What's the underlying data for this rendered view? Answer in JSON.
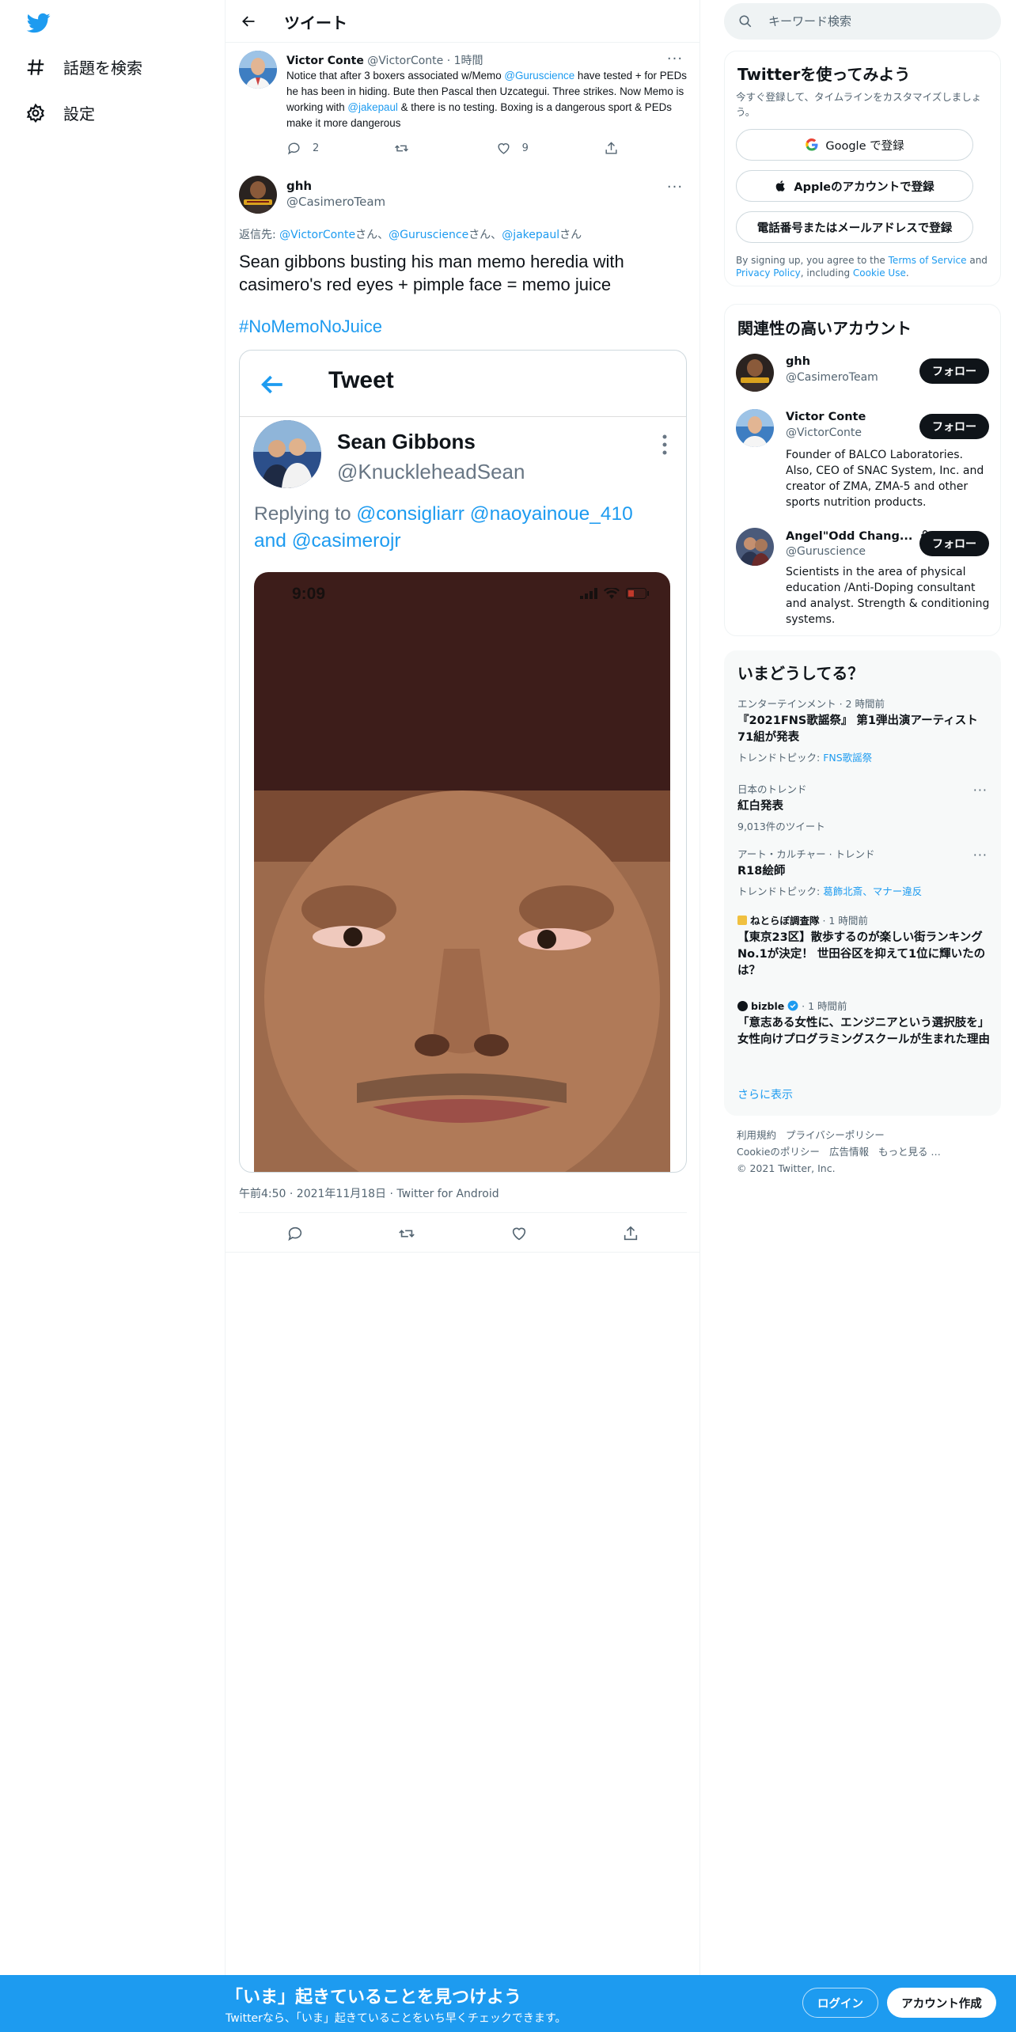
{
  "nav": {
    "explore_label": "話題を検索",
    "settings_label": "設定"
  },
  "header": {
    "title": "ツイート"
  },
  "parent_tweet": {
    "name": "Victor Conte",
    "handle": "@VictorConte",
    "time": "· 1時間",
    "text_part1": "Notice that after 3 boxers associated w/Memo ",
    "mention1": "@Guruscience",
    "text_part2": " have tested + for PEDs he has been in hiding.  Bute then Pascal then Uzcategui. Three strikes.  Now Memo is working with ",
    "mention2": "@jakepaul",
    "text_part3": " & there is no testing. Boxing is a dangerous sport & PEDs make it more dangerous",
    "reply_count": "2",
    "retweet_count": "",
    "like_count": "9"
  },
  "main_tweet": {
    "name": "ghh",
    "handle": "@CasimeroTeam",
    "reply_prefix": "返信先: ",
    "reply_mentions": [
      "@VictorConte",
      "さん、",
      "@Guruscience",
      "さん、",
      "@jakepaul",
      "さん"
    ],
    "text": "Sean gibbons busting his man memo heredia with casimero's red eyes + pimple face = memo juice",
    "hashtag": "#NoMemoNoJuice",
    "timestamp": "午前4:50 · 2021年11月18日 · Twitter for Android"
  },
  "embedded_image": {
    "header_title": "Tweet",
    "name": "Sean Gibbons",
    "handle": "@KnuckleheadSean",
    "reply_label": "Replying to ",
    "reply_mentions": "@consigliarr @naoyainoue_410",
    "reply_and": "and ",
    "reply_last": "@casimerojr",
    "phone_time": "9:09"
  },
  "search": {
    "placeholder": "キーワード検索"
  },
  "signup_panel": {
    "title": "Twitterを使ってみよう",
    "subtitle": "今すぐ登録して、タイムラインをカスタマイズしましょう。",
    "google_label": "Google で登録",
    "apple_label": "Appleのアカウントで登録",
    "phone_label": "電話番号またはメールアドレスで登録",
    "terms_part1": "By signing up, you agree to the ",
    "terms_link": "Terms of Service",
    "terms_part2": " and ",
    "privacy_link": "Privacy Policy",
    "terms_part3": ", including ",
    "cookie_link": "Cookie Use",
    "terms_part4": "."
  },
  "related_panel": {
    "title": "関連性の高いアカウント",
    "follow_label": "フォロー",
    "accounts": [
      {
        "name": "ghh",
        "handle": "@CasimeroTeam",
        "bio": ""
      },
      {
        "name": "Victor Conte",
        "handle": "@VictorConte",
        "bio": "Founder of BALCO Laboratories. Also, CEO of SNAC System, Inc. and creator of ZMA, ZMA-5 and other sports nutrition products."
      },
      {
        "name": "Angel\"Odd Chang...",
        "handle": "@Guruscience",
        "bio": "Scientists in the area of physical education /Anti-Doping consultant and analyst. Strength & conditioning systems."
      }
    ]
  },
  "trends_panel": {
    "title": "いまどうしてる？",
    "show_more": "さらに表示",
    "items": [
      {
        "meta": "エンターテインメント · 2 時間前",
        "title": "『2021FNS歌謡祭』 第1弾出演アーティスト71組が発表",
        "sub_label": "トレンドトピック: ",
        "sub_link": "FNS歌謡祭"
      },
      {
        "meta": "日本のトレンド",
        "title": "紅白発表",
        "sub_label": "9,013件のツイート",
        "sub_link": ""
      },
      {
        "meta": "アート・カルチャー · トレンド",
        "title": "R18絵師",
        "sub_label": "トレンドトピック: ",
        "sub_link": "葛飾北斎、マナー違反"
      },
      {
        "meta_name": "ねとらぼ調査隊",
        "meta": " · 1 時間前",
        "title": "【東京23区】散歩するのが楽しい街ランキングNo.1が決定！ 世田谷区を抑えて1位に輝いたのは？"
      },
      {
        "meta_name": "bizble",
        "meta": " · 1 時間前",
        "title": "「意志ある女性に、エンジニアという選択肢を」　女性向けプログラミングスクールが生まれた理由"
      }
    ]
  },
  "footer": {
    "links": [
      "利用規約",
      "プライバシーポリシー",
      "Cookieのポリシー",
      "広告情報",
      "もっと見る …"
    ],
    "copyright": "© 2021 Twitter, Inc."
  },
  "bottom_bar": {
    "title": "「いま」起きていることを見つけよう",
    "subtitle": "Twitterなら、「いま」起きていることをいち早くチェックできます。",
    "login_label": "ログイン",
    "signup_label": "アカウント作成"
  },
  "colors": {
    "accent": "#1d9bf0",
    "text": "#0f1419",
    "muted": "#536471"
  }
}
